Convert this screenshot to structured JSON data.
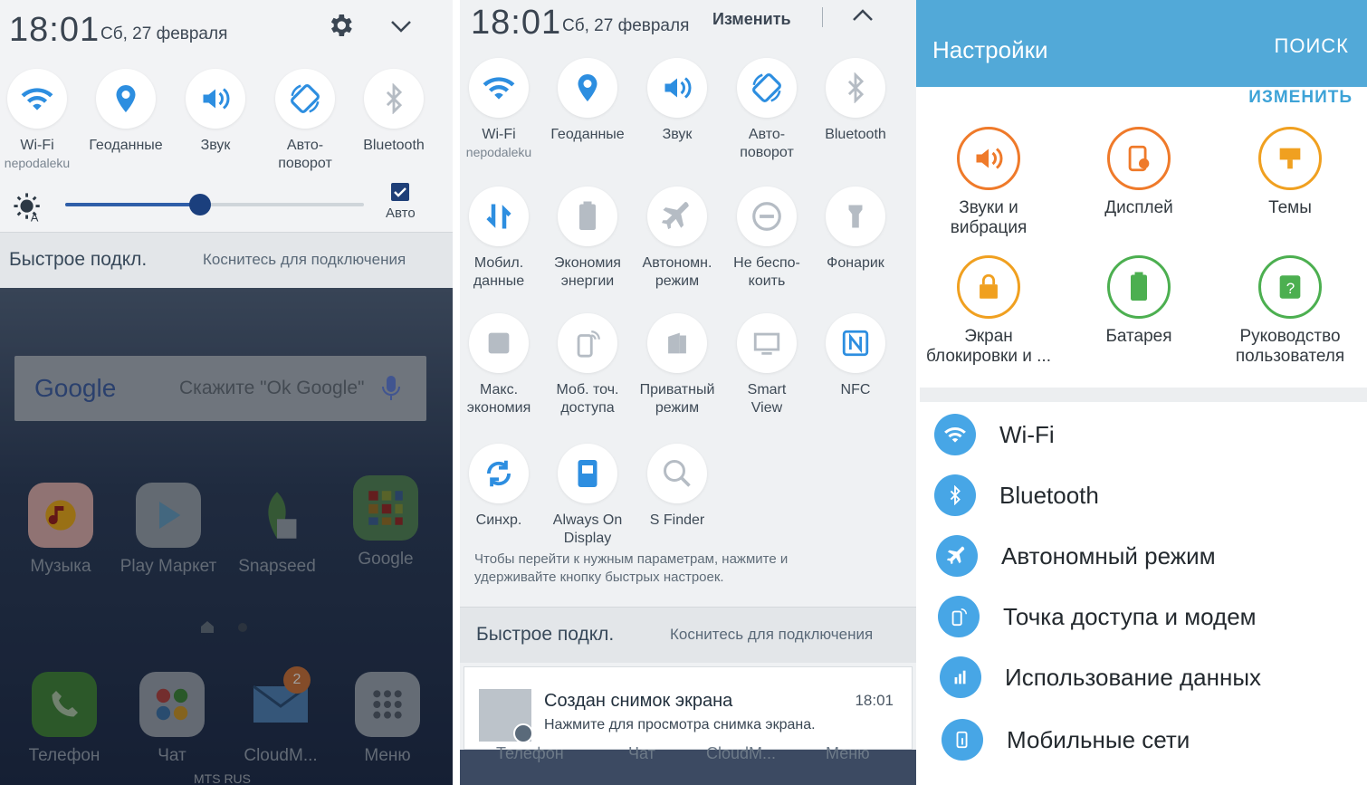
{
  "panel1": {
    "time": "18:01",
    "date": "Сб, 27 февраля",
    "tiles": [
      {
        "label": "Wi-Fi",
        "sub": "nepodaleku"
      },
      {
        "label": "Геоданные",
        "sub": ""
      },
      {
        "label": "Звук",
        "sub": ""
      },
      {
        "label": "Авто-\nповорот",
        "sub": ""
      },
      {
        "label": "Bluetooth",
        "sub": ""
      }
    ],
    "brightness_fraction": 0.45,
    "auto_label": "Авто",
    "quick_connect": "Быстрое подкл.",
    "quick_hint": "Коснитесь для подключения",
    "search_placeholder": "Скажите \"Ok Google\"",
    "google_logo": "Google",
    "apps_row1": [
      "Музыка",
      "Play Маркет",
      "Snapseed",
      "Google"
    ],
    "apps_row2": [
      "Телефон",
      "Чат",
      "CloudM...",
      "Меню"
    ],
    "badge_count": "2",
    "carrier": "MTS RUS"
  },
  "panel2": {
    "time": "18:01",
    "date": "Сб, 27 февраля",
    "edit_label": "Изменить",
    "tiles": [
      {
        "label": "Wi-Fi",
        "sub": "nepodaleku"
      },
      {
        "label": "Геоданные",
        "sub": ""
      },
      {
        "label": "Звук",
        "sub": ""
      },
      {
        "label": "Авто-\nповорот",
        "sub": ""
      },
      {
        "label": "Bluetooth",
        "sub": ""
      },
      {
        "label": "Мобил.\nданные",
        "sub": ""
      },
      {
        "label": "Экономия\nэнергии",
        "sub": ""
      },
      {
        "label": "Автономн.\nрежим",
        "sub": ""
      },
      {
        "label": "Не беспо-\nкоить",
        "sub": ""
      },
      {
        "label": "Фонарик",
        "sub": ""
      },
      {
        "label": "Макс.\nэкономия",
        "sub": ""
      },
      {
        "label": "Моб. точ.\nдоступа",
        "sub": ""
      },
      {
        "label": "Приватный\nрежим",
        "sub": ""
      },
      {
        "label": "Smart\nView",
        "sub": ""
      },
      {
        "label": "NFC",
        "sub": ""
      },
      {
        "label": "Синхр.",
        "sub": ""
      },
      {
        "label": "Always On\nDisplay",
        "sub": ""
      },
      {
        "label": "S Finder",
        "sub": ""
      }
    ],
    "hint": "Чтобы перейти к нужным параметрам, нажмите и удерживайте кнопку быстрых настроек.",
    "quick_connect": "Быстрое подкл.",
    "quick_hint": "Коснитесь для подключения",
    "notification": {
      "title": "Создан снимок экрана",
      "body": "Нажмите для просмотра снимка экрана.",
      "time": "18:01"
    },
    "bottom_labels": [
      "Телефон",
      "Чат",
      "CloudM...",
      "Меню"
    ]
  },
  "panel3": {
    "title": "Настройки",
    "search": "ПОИСК",
    "edit": "ИЗМЕНИТЬ",
    "grid": [
      {
        "label": "Звуки и\nвибрация",
        "color": "#ef7a2a"
      },
      {
        "label": "Дисплей",
        "color": "#ef7a2a"
      },
      {
        "label": "Темы",
        "color": "#f0a020"
      },
      {
        "label": "Экран\nблокировки и ...",
        "color": "#f0a020"
      },
      {
        "label": "Батарея",
        "color": "#4caf50"
      },
      {
        "label": "Руководство\nпользователя",
        "color": "#4caf50"
      }
    ],
    "list": [
      "Wi-Fi",
      "Bluetooth",
      "Автономный режим",
      "Точка доступа и модем",
      "Использование данных",
      "Мобильные сети"
    ]
  }
}
